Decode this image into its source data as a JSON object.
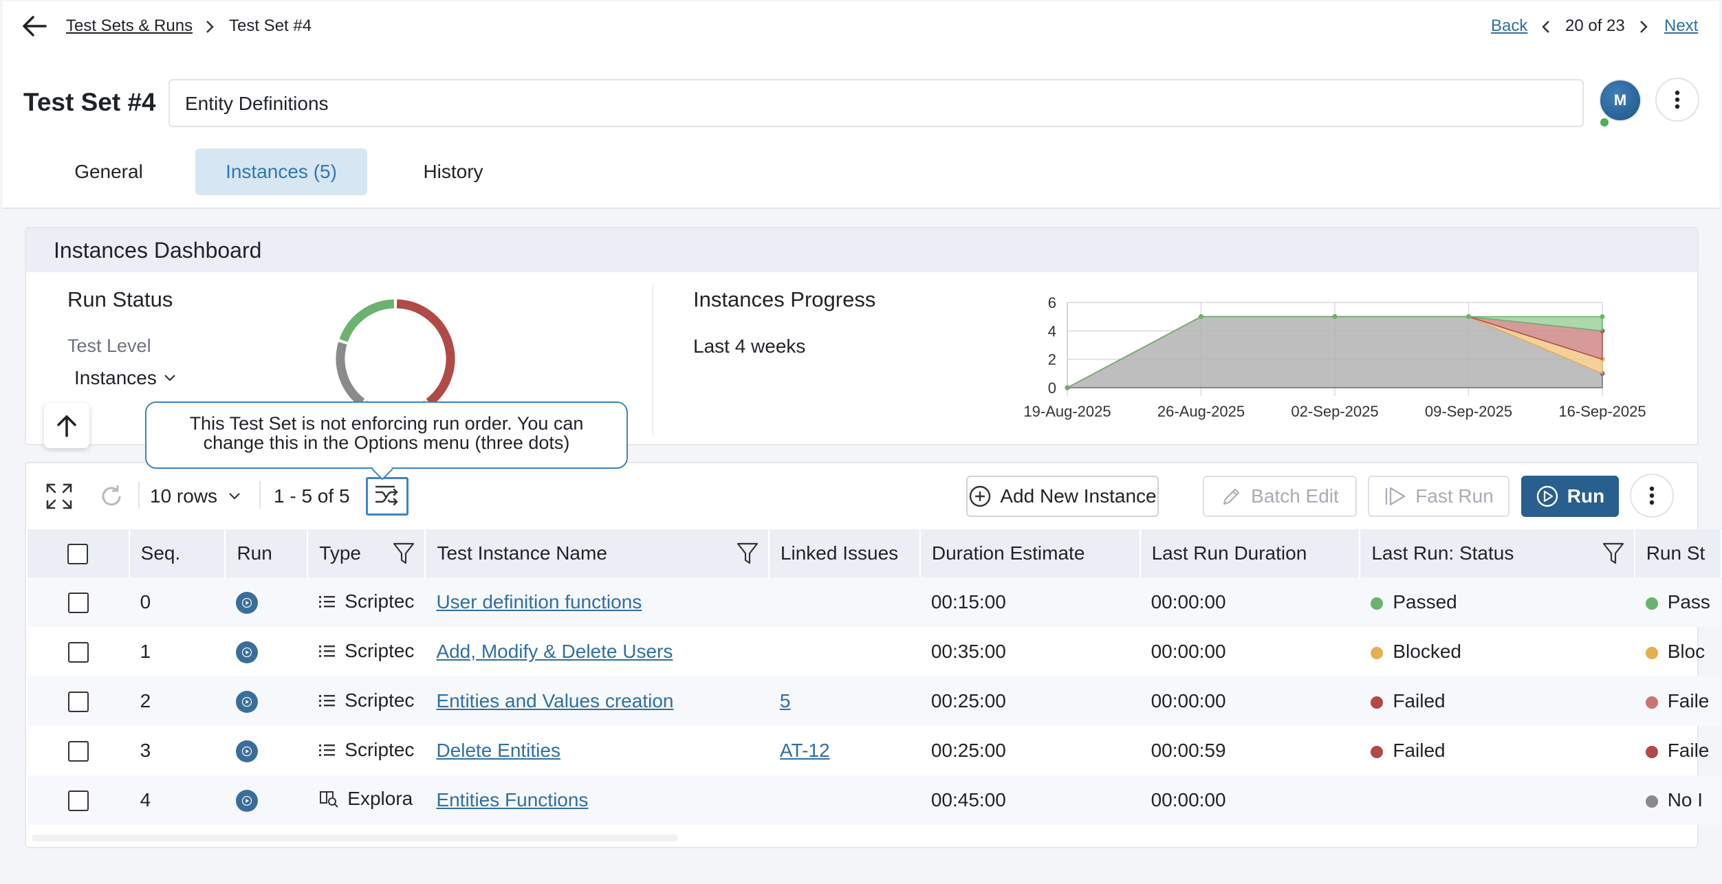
{
  "breadcrumb": {
    "parent": "Test Sets & Runs",
    "current": "Test Set #4"
  },
  "pager": {
    "back": "Back",
    "position": "20 of 23",
    "next": "Next"
  },
  "title": "Test Set #4",
  "name_value": "Entity Definitions",
  "avatar": {
    "initial": "M"
  },
  "tabs": [
    {
      "label": "General",
      "active": false
    },
    {
      "label": "Instances (5)",
      "active": true
    },
    {
      "label": "History",
      "active": false
    }
  ],
  "dashboard": {
    "title": "Instances Dashboard",
    "run_status": {
      "title": "Run Status",
      "level_label": "Test Level",
      "level_value": "Instances"
    },
    "progress": {
      "title": "Instances Progress",
      "range": "Last 4 weeks"
    }
  },
  "tooltip": {
    "line1": "This Test Set is not enforcing run order. You can",
    "line2": "change this in the Options menu (three dots)"
  },
  "toolbar": {
    "rows": "10 rows",
    "range": "1 - 5 of 5",
    "add_new": "Add New Instance",
    "batch_edit": "Batch Edit",
    "fast_run": "Fast Run",
    "run": "Run"
  },
  "table": {
    "headers": {
      "seq": "Seq.",
      "run": "Run",
      "type": "Type",
      "name": "Test Instance Name",
      "linked": "Linked Issues",
      "est": "Duration Estimate",
      "lrd": "Last Run Duration",
      "lrs": "Last Run: Status",
      "rs": "Run St"
    },
    "rows": [
      {
        "seq": "0",
        "type": "Scriptec",
        "name": "User definition functions",
        "linked": "",
        "est": "00:15:00",
        "lrd": "00:00:00",
        "status": "Passed",
        "run_status": "Pass"
      },
      {
        "seq": "1",
        "type": "Scriptec",
        "name": "Add, Modify & Delete Users",
        "linked": "",
        "est": "00:35:00",
        "lrd": "00:00:00",
        "status": "Blocked",
        "run_status": "Bloc"
      },
      {
        "seq": "2",
        "type": "Scriptec",
        "name": "Entities and Values creation",
        "linked": "5",
        "est": "00:25:00",
        "lrd": "00:00:00",
        "status": "Failed",
        "run_status": "Faile"
      },
      {
        "seq": "3",
        "type": "Scriptec",
        "name": "Delete Entities",
        "linked": "AT-12",
        "est": "00:25:00",
        "lrd": "00:00:59",
        "status": "Failed",
        "run_status": "Faile"
      },
      {
        "seq": "4",
        "type": "Explora",
        "name": "Entities Functions",
        "linked": "",
        "est": "00:45:00",
        "lrd": "00:00:00",
        "status": "",
        "run_status": "No I"
      }
    ]
  },
  "colors": {
    "passed": "#6cb26f",
    "blocked": "#e7ae50",
    "failed": "#b04a47",
    "failed_light": "#c97470",
    "not_run": "#8a8a8a",
    "accent": "#285f8e"
  },
  "chart_data": [
    {
      "type": "pie",
      "title": "Run Status",
      "categories": [
        "Passed",
        "Failed",
        "Blocked",
        "No Run"
      ],
      "values": [
        1,
        2,
        1,
        1
      ]
    },
    {
      "type": "area",
      "title": "Instances Progress",
      "x": [
        "19-Aug-2025",
        "26-Aug-2025",
        "02-Sep-2025",
        "09-Sep-2025",
        "16-Sep-2025"
      ],
      "series": [
        {
          "values": [
            0,
            5,
            5,
            5,
            1
          ]
        },
        {
          "values": [
            0,
            0,
            0,
            0,
            1
          ]
        },
        {
          "values": [
            0,
            0,
            0,
            0,
            2
          ]
        },
        {
          "values": [
            0,
            0,
            0,
            0,
            1
          ]
        }
      ],
      "ylim": [
        0,
        6
      ],
      "yticks": [
        0,
        2,
        4,
        6
      ],
      "grid": true
    }
  ]
}
